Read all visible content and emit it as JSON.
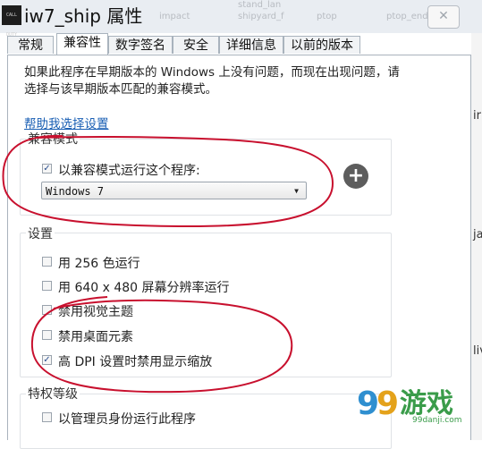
{
  "window": {
    "title": "iw7_ship 属性",
    "app_icon_text": "CALL DUTY"
  },
  "background_labels": [
    "impact",
    "stand_lan",
    "shipyard_f",
    "ptop",
    "ptop_end"
  ],
  "background_side_letters": [
    "ir",
    "ja",
    "liv"
  ],
  "tabs": [
    {
      "label": "常规"
    },
    {
      "label": "兼容性"
    },
    {
      "label": "数字签名"
    },
    {
      "label": "安全"
    },
    {
      "label": "详细信息"
    },
    {
      "label": "以前的版本"
    }
  ],
  "description": "如果此程序在早期版本的 Windows 上没有问题，而现在出现问题，请选择与该早期版本匹配的兼容模式。",
  "help_link": "帮助我选择设置",
  "compat_mode": {
    "group_label": "兼容模式",
    "checkbox_label": "以兼容模式运行这个程序:",
    "checked": true,
    "selected_os": "Windows 7"
  },
  "settings": {
    "group_label": "设置",
    "items": [
      {
        "label": "用 256 色运行",
        "checked": false
      },
      {
        "label": "用 640 x 480 屏幕分辨率运行",
        "checked": false
      },
      {
        "label": "禁用视觉主题",
        "checked": false
      },
      {
        "label": "禁用桌面元素",
        "checked": false
      },
      {
        "label": "高 DPI 设置时禁用显示缩放",
        "checked": true
      }
    ]
  },
  "privilege": {
    "group_label": "特权等级",
    "items": [
      {
        "label": "以管理员身份运行此程序",
        "checked": false
      }
    ]
  },
  "watermark": {
    "text": "99danji.com"
  },
  "colors": {
    "annotation_red": "#c8102e",
    "link_blue": "#1a5fb4",
    "watermark_green": "#3a9c4a"
  }
}
